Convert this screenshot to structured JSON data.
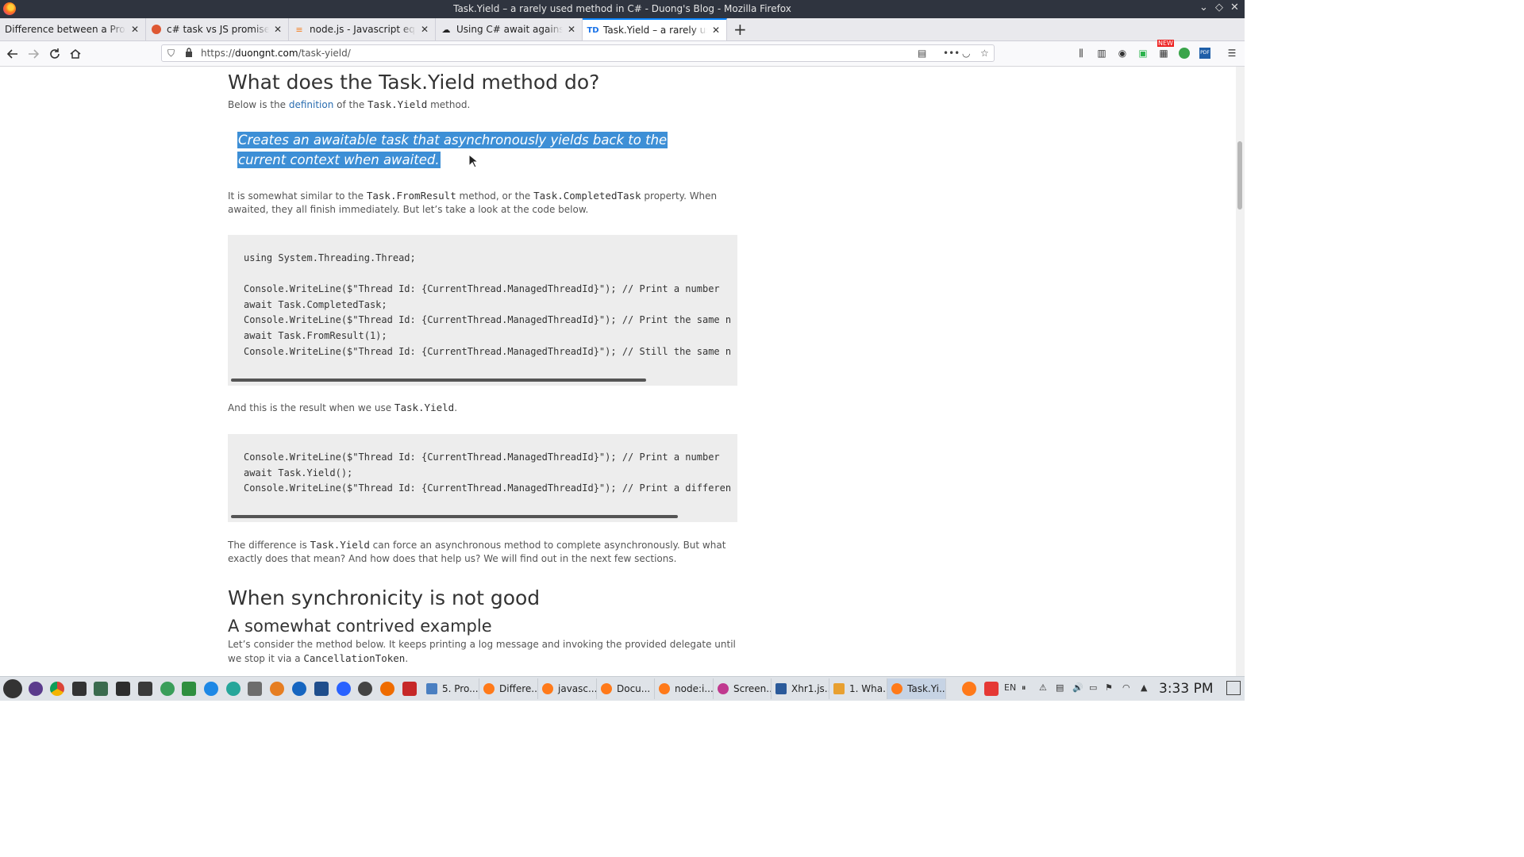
{
  "window": {
    "title": "Task.Yield – a rarely used method in C# - Duong's Blog - Mozilla Firefox"
  },
  "tabs": [
    {
      "label": "Difference between a Promise",
      "icon": "page-icon"
    },
    {
      "label": "c# task vs JS promise at Du",
      "icon": "duckduckgo-icon"
    },
    {
      "label": "node.js - Javascript equiva",
      "icon": "stackoverflow-icon"
    },
    {
      "label": "Using C# await against JS",
      "icon": "cloud-icon"
    },
    {
      "label": "Task.Yield – a rarely used m",
      "icon": "td-icon",
      "active": true
    }
  ],
  "navbar": {
    "url_prefix": "https://",
    "url_host": "duongnt.com",
    "url_path": "/task-yield/"
  },
  "article": {
    "h_what": "What does the Task.Yield method do?",
    "p1_a": "Below is the ",
    "p1_link": "definition",
    "p1_b": " of the ",
    "p1_code": "Task.Yield",
    "p1_c": " method.",
    "quote": "Creates an awaitable task that asynchronously yields back to the current context when awaited.",
    "p2_a": "It is somewhat similar to the ",
    "p2_code1": "Task.FromResult",
    "p2_b": " method, or the ",
    "p2_code2": "Task.CompletedTask",
    "p2_c": " property. When awaited, they all finish immediately. But let’s take a look at the code below.",
    "code1": "using System.Threading.Thread;\n\nConsole.WriteLine($\"Thread Id: {CurrentThread.ManagedThreadId}\"); // Print a number\nawait Task.CompletedTask;\nConsole.WriteLine($\"Thread Id: {CurrentThread.ManagedThreadId}\"); // Print the same n\nawait Task.FromResult(1);\nConsole.WriteLine($\"Thread Id: {CurrentThread.ManagedThreadId}\"); // Still the same n",
    "p3_a": "And this is the result when we use ",
    "p3_code": "Task.Yield",
    "p3_b": ".",
    "code2": "Console.WriteLine($\"Thread Id: {CurrentThread.ManagedThreadId}\"); // Print a number\nawait Task.Yield();\nConsole.WriteLine($\"Thread Id: {CurrentThread.ManagedThreadId}\"); // Print a differen",
    "p4_a": "The difference is ",
    "p4_code": "Task.Yield",
    "p4_b": " can force an asynchronous method to complete asynchronously. But what exactly does that mean? And how does that help us? We will find out in the next few sections.",
    "h_sync": "When synchronicity is not good",
    "h_example": "A somewhat contrived example",
    "p5_a": "Let’s consider the method below. It keeps printing a log message and invoking the provided delegate until we stop it via a ",
    "p5_code": "CancellationToken",
    "p5_b": "."
  },
  "taskbar": {
    "windows": [
      {
        "label": "5. Pro...",
        "color": "#4a7fc1"
      },
      {
        "label": "Differe...",
        "color": "#ff7a1a"
      },
      {
        "label": "javasc...",
        "color": "#ff7a1a"
      },
      {
        "label": "Docu...",
        "color": "#ff7a1a"
      },
      {
        "label": "node:i...",
        "color": "#ff7a1a"
      },
      {
        "label": "Screen...",
        "color": "#c0398f"
      },
      {
        "label": "Xhr1.js...",
        "color": "#2b5a9a"
      },
      {
        "label": "1. Wha...",
        "color": "#e8a030"
      },
      {
        "label": "Task.Yi...",
        "color": "#ff7a1a",
        "active": true
      }
    ],
    "lang": "EN",
    "time": "3:33 PM"
  },
  "ext_badge": "NEW"
}
